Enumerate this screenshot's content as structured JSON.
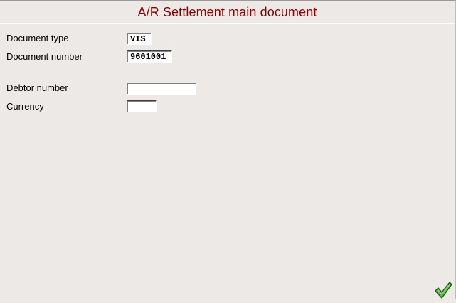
{
  "window": {
    "title": "A/R Settlement main document"
  },
  "form": {
    "document_type": {
      "label": "Document type",
      "value": "VIS"
    },
    "document_number": {
      "label": "Document number",
      "value": "9601001"
    },
    "debtor_number": {
      "label": "Debtor number",
      "value": ""
    },
    "currency": {
      "label": "Currency",
      "value": ""
    }
  },
  "actions": {
    "ok_icon": "checkmark-icon"
  },
  "colors": {
    "title": "#8b0000",
    "background": "#ece9e6",
    "checkmark": "#3a9a2a"
  }
}
